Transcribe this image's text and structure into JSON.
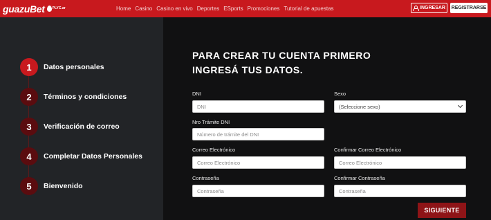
{
  "header": {
    "logo_text": "guazuBet",
    "logo_badge": "PLYC.ar",
    "nav": [
      "Home",
      "Casino",
      "Casino en vivo",
      "Deportes",
      "ESports",
      "Promociones",
      "Tutorial de apuestas"
    ],
    "login_label": "INGRESAR",
    "register_label": "REGISTRARSE"
  },
  "steps": [
    {
      "num": "1",
      "label": "Datos personales",
      "active": true
    },
    {
      "num": "2",
      "label": "Términos y condiciones"
    },
    {
      "num": "3",
      "label": "Verificación de correo"
    },
    {
      "num": "4",
      "label": "Completar Datos Personales"
    },
    {
      "num": "5",
      "label": "Bienvenido"
    }
  ],
  "form": {
    "title_line1": "PARA CREAR TU CUENTA PRIMERO",
    "title_line2": "INGRESÁ TUS DATOS.",
    "dni_label": "DNI",
    "dni_placeholder": "DNI",
    "sexo_label": "Sexo",
    "sexo_value": "(Seleccione sexo)",
    "tramite_label": "Nro Trámite DNI",
    "tramite_placeholder": "Número de trámite del DNI",
    "email_label": "Correo Electrónico",
    "email_placeholder": "Correo Electrónico",
    "email_confirm_label": "Confirmar Correo Electrónico",
    "email_confirm_placeholder": "Correo Electrónico",
    "password_label": "Contraseña",
    "password_placeholder": "Contraseña",
    "password_confirm_label": "Confirmar Contraseña",
    "password_confirm_placeholder": "Contraseña",
    "next_label": "SIGUIENTE"
  },
  "colors": {
    "brand_red": "#c8191e",
    "step_inactive": "#5a0c0f",
    "left_bg": "#222427",
    "right_bg": "#111112"
  }
}
